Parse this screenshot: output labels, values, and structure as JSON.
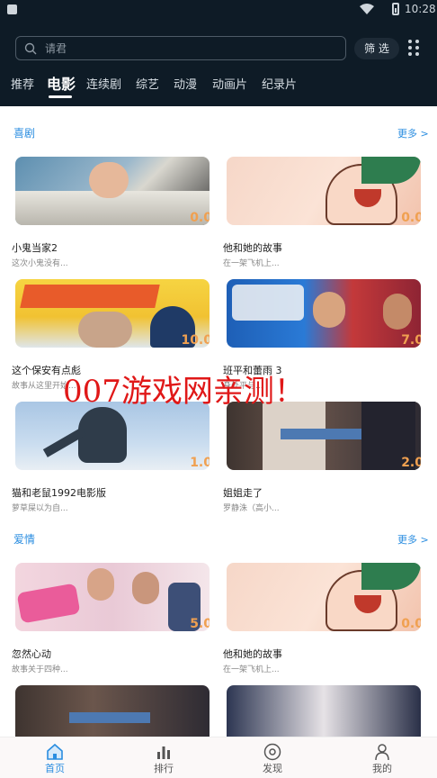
{
  "status_bar": {
    "time": "10:28"
  },
  "search": {
    "placeholder": "请君"
  },
  "header": {
    "filter_label": "筛 选"
  },
  "tabs": [
    {
      "label": "推荐",
      "active": false
    },
    {
      "label": "电影",
      "active": true
    },
    {
      "label": "连续剧",
      "active": false
    },
    {
      "label": "综艺",
      "active": false
    },
    {
      "label": "动漫",
      "active": false
    },
    {
      "label": "动画片",
      "active": false
    },
    {
      "label": "纪录片",
      "active": false
    }
  ],
  "sections": [
    {
      "title": "喜剧",
      "more": "更多 >",
      "items": [
        {
          "title": "小鬼当家2",
          "desc": "这次小鬼没有...",
          "score": "0.0"
        },
        {
          "title": "他和她的故事",
          "desc": "在一架飞机上...",
          "score": "0.0"
        },
        {
          "title": "这个保安有点彪",
          "desc": "故事从这里开始...",
          "score": "10.0"
        },
        {
          "title": "班平和蕾雨 3",
          "desc": "身处平与...",
          "score": "7.0"
        },
        {
          "title": "猫和老鼠1992电影版",
          "desc": "萝草屎以为自...",
          "score": "1.0"
        },
        {
          "title": "姐姐走了",
          "desc": "罗静洙（高小...",
          "score": "2.0"
        }
      ]
    },
    {
      "title": "爱情",
      "more": "更多 >",
      "items": [
        {
          "title": "忽然心动",
          "desc": "故事关于四种...",
          "score": "5.0"
        },
        {
          "title": "他和她的故事",
          "desc": "在一架飞机上...",
          "score": "0.0"
        }
      ]
    }
  ],
  "watermark": "007游戏网亲测！",
  "bottom_nav": [
    {
      "label": "首页",
      "active": true
    },
    {
      "label": "排行",
      "active": false
    },
    {
      "label": "发现",
      "active": false
    },
    {
      "label": "我的",
      "active": false
    }
  ],
  "colors": {
    "header_bg": "#0e1b26",
    "accent": "#2a8de0",
    "score": "#f0a050",
    "watermark": "#e01818"
  }
}
